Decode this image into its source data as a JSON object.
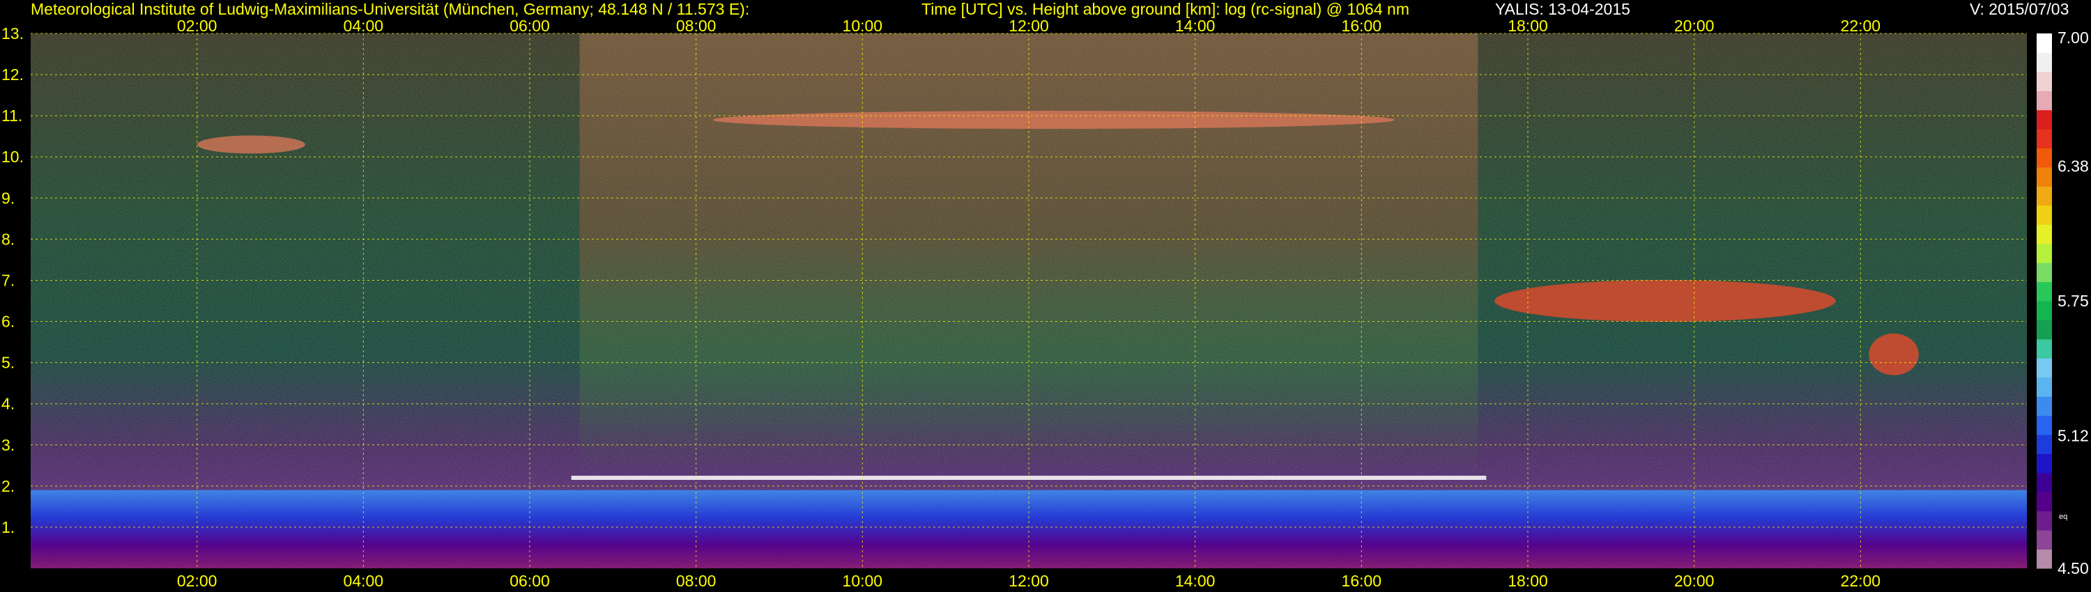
{
  "header": {
    "institute": "Meteorological Institute of Ludwig-Maximilians-Universität (München, Germany; 48.148 N / 11.573 E):",
    "plot_title": "Time [UTC] vs. Height above ground [km]: log (rc-signal) @ 1064 nm",
    "instrument_date": "YALIS: 13-04-2015",
    "version": "V: 2015/07/03"
  },
  "chart_data": {
    "type": "heatmap",
    "title": "Time [UTC] vs. Height above ground [km]: log (rc-signal) @ 1064 nm",
    "x_ticks": [
      "02:00",
      "04:00",
      "06:00",
      "08:00",
      "10:00",
      "12:00",
      "14:00",
      "16:00",
      "18:00",
      "20:00",
      "22:00"
    ],
    "x_tick_hours": [
      2,
      4,
      6,
      8,
      10,
      12,
      14,
      16,
      18,
      20,
      22
    ],
    "xlim_hours": [
      0,
      24
    ],
    "y_ticks": [
      "1.",
      "2.",
      "3.",
      "4.",
      "5.",
      "6.",
      "7.",
      "8.",
      "9.",
      "10.",
      "11.",
      "12.",
      "13."
    ],
    "y_tick_values": [
      1,
      2,
      3,
      4,
      5,
      6,
      7,
      8,
      9,
      10,
      11,
      12,
      13
    ],
    "ylim_km": [
      0,
      13
    ],
    "grid": true,
    "colorbar": {
      "labels": [
        "7.00",
        "6.38",
        "5.75",
        "5.12",
        "4.50"
      ],
      "label_values": [
        7.0,
        6.38,
        5.75,
        5.12,
        4.5
      ],
      "range": [
        4.5,
        7.0
      ],
      "tiny_label": "eq",
      "colors": [
        "#b48caa",
        "#8c4696",
        "#6e1e8c",
        "#55008c",
        "#3c0096",
        "#1e14c8",
        "#1e3cdc",
        "#2864f0",
        "#3c8cf0",
        "#5ab4f0",
        "#78c8f0",
        "#3cc8a0",
        "#14a050",
        "#14b450",
        "#28c85a",
        "#78dc64",
        "#b4f03c",
        "#e6f028",
        "#f0d214",
        "#f0aa14",
        "#f0820a",
        "#f05a0a",
        "#e6321e",
        "#dc1e1e",
        "#e6aab4",
        "#f0d2d2",
        "#f0f0f0",
        "#ffffff"
      ]
    },
    "features": [
      {
        "name": "aerosol boundary layer",
        "t_start": 0,
        "t_end": 24,
        "z_bottom_km": 0,
        "z_top_km": 1.9
      },
      {
        "name": "boundary layer top / low cloud",
        "t_start": 6.5,
        "t_end": 17.5,
        "height_km": 2.2
      },
      {
        "name": "cirrus",
        "t_start": 2,
        "t_end": 3.3,
        "height_km": 10.3
      },
      {
        "name": "cirrus",
        "t_start": 8.2,
        "t_end": 16.4,
        "height_km": 10.9
      },
      {
        "name": "mid-level cloud",
        "t_start": 17.6,
        "t_end": 21.7,
        "height_km": 6.5
      },
      {
        "name": "mid-level cloud",
        "t_start": 22.1,
        "t_end": 22.7,
        "height_km": 5.2
      }
    ]
  }
}
